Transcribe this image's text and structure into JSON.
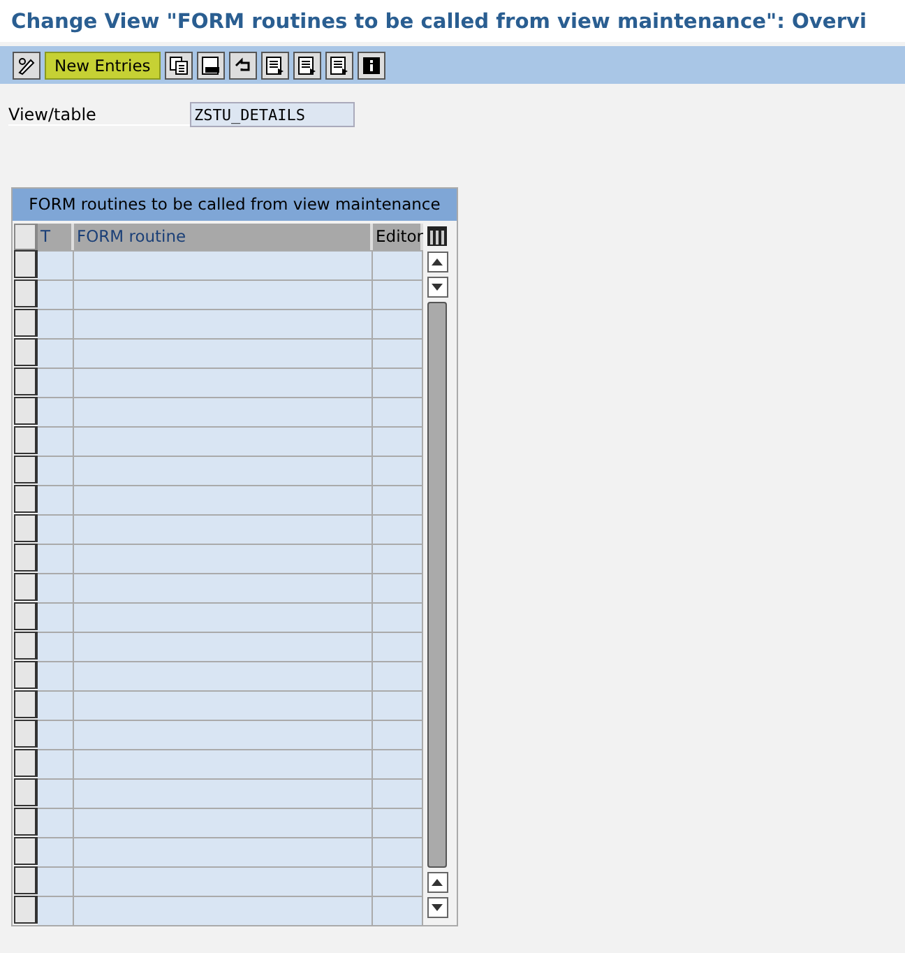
{
  "window": {
    "title": "Change View \"FORM routines to be called from view maintenance\": Overvi"
  },
  "toolbar": {
    "button": "New Entries"
  },
  "field": {
    "label": "View/table",
    "value": "ZSTU_DETAILS"
  },
  "table": {
    "title": "FORM routines to be called from view maintenance",
    "columns": [
      "T",
      "FORM routine",
      "Editor"
    ]
  }
}
